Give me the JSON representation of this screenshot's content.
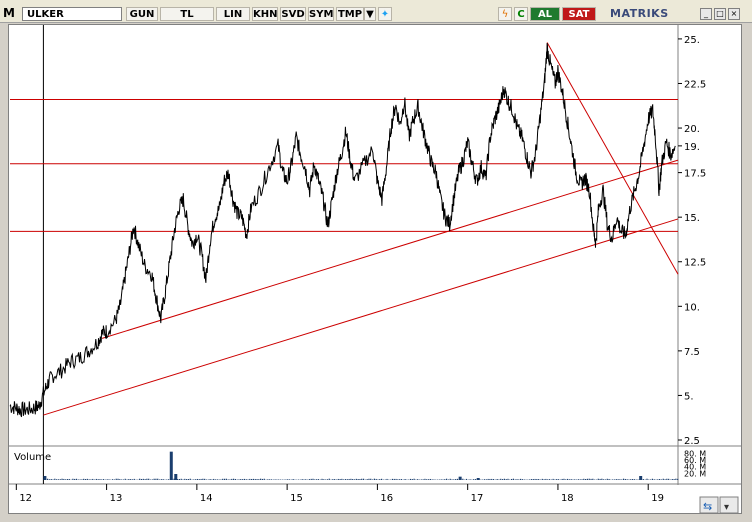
{
  "toolbar": {
    "menu_label": "M",
    "symbol": "ULKER",
    "buttons": [
      "GUN",
      "TL",
      "LIN",
      "KHN",
      "SVD",
      "SYM",
      "TMP"
    ],
    "al_label": "AL",
    "sat_label": "SAT",
    "brand": "MATRIKS"
  },
  "colors": {
    "price_line": "#000000",
    "support_lines": "#cc0000",
    "volume_bars": "#1a3e6e"
  },
  "chart_data": {
    "type": "line",
    "x_ticks": [
      "12",
      "13",
      "14",
      "15",
      "16",
      "17",
      "18",
      "19"
    ],
    "y_ticks": [
      "25.",
      "22.5",
      "20.",
      "19.",
      "17.5",
      "15.",
      "12.5",
      "10.",
      "7.5",
      "5.",
      "2.5"
    ],
    "ylim": [
      2.5,
      25.5
    ],
    "xlim": [
      11.93,
      19.33
    ],
    "price_series": [
      [
        11.93,
        4.4
      ],
      [
        12.0,
        4.3
      ],
      [
        12.05,
        4.2
      ],
      [
        12.12,
        4.2
      ],
      [
        12.2,
        4.3
      ],
      [
        12.25,
        4.4
      ],
      [
        12.3,
        5.1
      ],
      [
        12.35,
        5.7
      ],
      [
        12.4,
        6.1
      ],
      [
        12.5,
        6.4
      ],
      [
        12.6,
        6.9
      ],
      [
        12.7,
        7.1
      ],
      [
        12.8,
        7.5
      ],
      [
        12.9,
        8.0
      ],
      [
        12.95,
        8.5
      ],
      [
        13.0,
        8.6
      ],
      [
        13.1,
        9.2
      ],
      [
        13.15,
        10.0
      ],
      [
        13.2,
        11.5
      ],
      [
        13.25,
        13.0
      ],
      [
        13.3,
        14.5
      ],
      [
        13.35,
        13.5
      ],
      [
        13.42,
        12.3
      ],
      [
        13.5,
        11.8
      ],
      [
        13.55,
        10.5
      ],
      [
        13.6,
        9.3
      ],
      [
        13.65,
        10.8
      ],
      [
        13.7,
        12.5
      ],
      [
        13.75,
        14.2
      ],
      [
        13.8,
        15.5
      ],
      [
        13.85,
        16.0
      ],
      [
        13.9,
        14.5
      ],
      [
        13.95,
        13.5
      ],
      [
        14.0,
        14.0
      ],
      [
        14.05,
        13.0
      ],
      [
        14.1,
        11.5
      ],
      [
        14.15,
        13.8
      ],
      [
        14.2,
        15.0
      ],
      [
        14.25,
        15.5
      ],
      [
        14.3,
        17.0
      ],
      [
        14.35,
        17.5
      ],
      [
        14.4,
        16.0
      ],
      [
        14.45,
        15.2
      ],
      [
        14.5,
        15.0
      ],
      [
        14.55,
        14.0
      ],
      [
        14.6,
        15.5
      ],
      [
        14.7,
        16.5
      ],
      [
        14.8,
        17.8
      ],
      [
        14.9,
        19.0
      ],
      [
        14.95,
        17.5
      ],
      [
        15.0,
        17.0
      ],
      [
        15.05,
        18.0
      ],
      [
        15.1,
        19.5
      ],
      [
        15.15,
        18.5
      ],
      [
        15.2,
        17.8
      ],
      [
        15.25,
        16.5
      ],
      [
        15.3,
        18.0
      ],
      [
        15.35,
        17.0
      ],
      [
        15.4,
        16.0
      ],
      [
        15.45,
        14.5
      ],
      [
        15.5,
        16.0
      ],
      [
        15.55,
        17.5
      ],
      [
        15.6,
        18.5
      ],
      [
        15.65,
        19.8
      ],
      [
        15.7,
        18.2
      ],
      [
        15.75,
        17.0
      ],
      [
        15.85,
        18.0
      ],
      [
        15.95,
        18.8
      ],
      [
        16.0,
        17.0
      ],
      [
        16.05,
        16.0
      ],
      [
        16.1,
        17.8
      ],
      [
        16.15,
        20.0
      ],
      [
        16.2,
        21.3
      ],
      [
        16.25,
        20.2
      ],
      [
        16.3,
        21.5
      ],
      [
        16.35,
        19.5
      ],
      [
        16.4,
        20.5
      ],
      [
        16.45,
        21.2
      ],
      [
        16.5,
        20.0
      ],
      [
        16.55,
        19.0
      ],
      [
        16.6,
        18.0
      ],
      [
        16.65,
        17.5
      ],
      [
        16.7,
        16.0
      ],
      [
        16.75,
        15.0
      ],
      [
        16.8,
        14.6
      ],
      [
        16.85,
        16.2
      ],
      [
        16.9,
        17.5
      ],
      [
        16.95,
        18.2
      ],
      [
        17.0,
        19.2
      ],
      [
        17.05,
        18.0
      ],
      [
        17.1,
        17.0
      ],
      [
        17.15,
        17.8
      ],
      [
        17.2,
        17.2
      ],
      [
        17.25,
        19.5
      ],
      [
        17.3,
        20.5
      ],
      [
        17.35,
        21.2
      ],
      [
        17.4,
        22.2
      ],
      [
        17.45,
        21.5
      ],
      [
        17.5,
        21.0
      ],
      [
        17.55,
        20.0
      ],
      [
        17.6,
        19.5
      ],
      [
        17.65,
        18.5
      ],
      [
        17.7,
        17.5
      ],
      [
        17.75,
        18.5
      ],
      [
        17.8,
        20.5
      ],
      [
        17.85,
        22.5
      ],
      [
        17.88,
        24.5
      ],
      [
        17.92,
        23.5
      ],
      [
        17.97,
        22.5
      ],
      [
        18.0,
        23.2
      ],
      [
        18.05,
        22.0
      ],
      [
        18.1,
        20.5
      ],
      [
        18.15,
        19.0
      ],
      [
        18.2,
        17.5
      ],
      [
        18.25,
        16.8
      ],
      [
        18.3,
        17.2
      ],
      [
        18.35,
        16.5
      ],
      [
        18.4,
        14.0
      ],
      [
        18.42,
        13.6
      ],
      [
        18.45,
        15.5
      ],
      [
        18.5,
        16.5
      ],
      [
        18.55,
        14.5
      ],
      [
        18.6,
        13.8
      ],
      [
        18.65,
        15.0
      ],
      [
        18.7,
        14.2
      ],
      [
        18.75,
        14.0
      ],
      [
        18.8,
        15.5
      ],
      [
        18.85,
        16.5
      ],
      [
        18.9,
        17.5
      ],
      [
        18.95,
        19.0
      ],
      [
        19.0,
        20.5
      ],
      [
        19.05,
        21.0
      ],
      [
        19.08,
        19.5
      ],
      [
        19.12,
        16.5
      ],
      [
        19.15,
        18.0
      ],
      [
        19.2,
        19.2
      ],
      [
        19.25,
        18.5
      ],
      [
        19.3,
        19.0
      ]
    ],
    "horizontal_lines": [
      21.6,
      18.0,
      14.2
    ],
    "trend_lines": [
      [
        [
          12.95,
          8.2
        ],
        [
          19.33,
          18.2
        ]
      ],
      [
        [
          12.3,
          3.9
        ],
        [
          19.33,
          14.9
        ]
      ],
      [
        [
          17.88,
          24.8
        ],
        [
          19.33,
          11.8
        ]
      ]
    ],
    "volume": {
      "label": "Volume",
      "ticks": [
        "80. M",
        "60. M",
        "40. M",
        "20. M"
      ],
      "max": 90,
      "spikes": [
        [
          12.3,
          12
        ],
        [
          13.7,
          85
        ],
        [
          13.75,
          18
        ],
        [
          16.9,
          10
        ],
        [
          17.1,
          6
        ],
        [
          18.9,
          12
        ]
      ]
    }
  }
}
